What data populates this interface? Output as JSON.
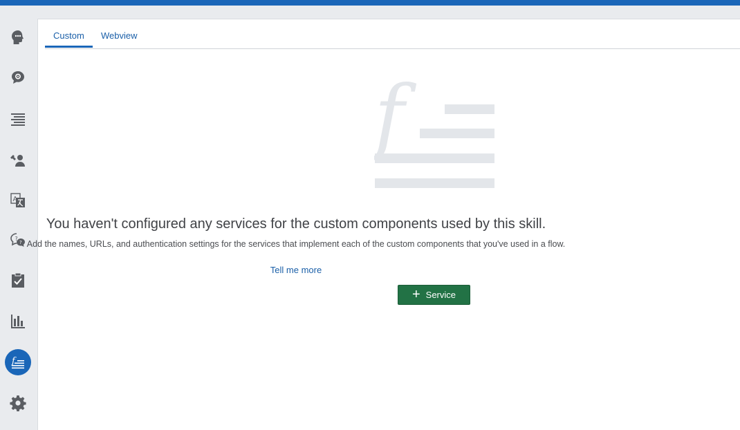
{
  "tabs": {
    "custom_label": "Custom",
    "webview_label": "Webview"
  },
  "sidebar": {
    "items": [
      {
        "icon": "head-icon"
      },
      {
        "icon": "chat-gear-icon"
      },
      {
        "icon": "text-lines-icon"
      },
      {
        "icon": "agent-tools-icon"
      },
      {
        "icon": "translate-icon"
      },
      {
        "icon": "question-chat-icon"
      },
      {
        "icon": "clipboard-check-icon"
      },
      {
        "icon": "bar-chart-icon"
      },
      {
        "icon": "function-icon"
      },
      {
        "icon": "settings-gear-icon"
      }
    ],
    "active_icon": "function-icon",
    "active_color": "#1a66b8"
  },
  "empty_state": {
    "icon": "function-list-icon",
    "title": "You haven't configured any services for the custom components used by this skill.",
    "description": "Add the names, URLs, and authentication settings for the services that implement each of the custom components that you've used in a flow.",
    "link_text": "Tell me more",
    "button_label": "Service",
    "button_color": "#227245"
  },
  "colors": {
    "accent": "#1a66b8",
    "link": "#1a5fa8"
  }
}
